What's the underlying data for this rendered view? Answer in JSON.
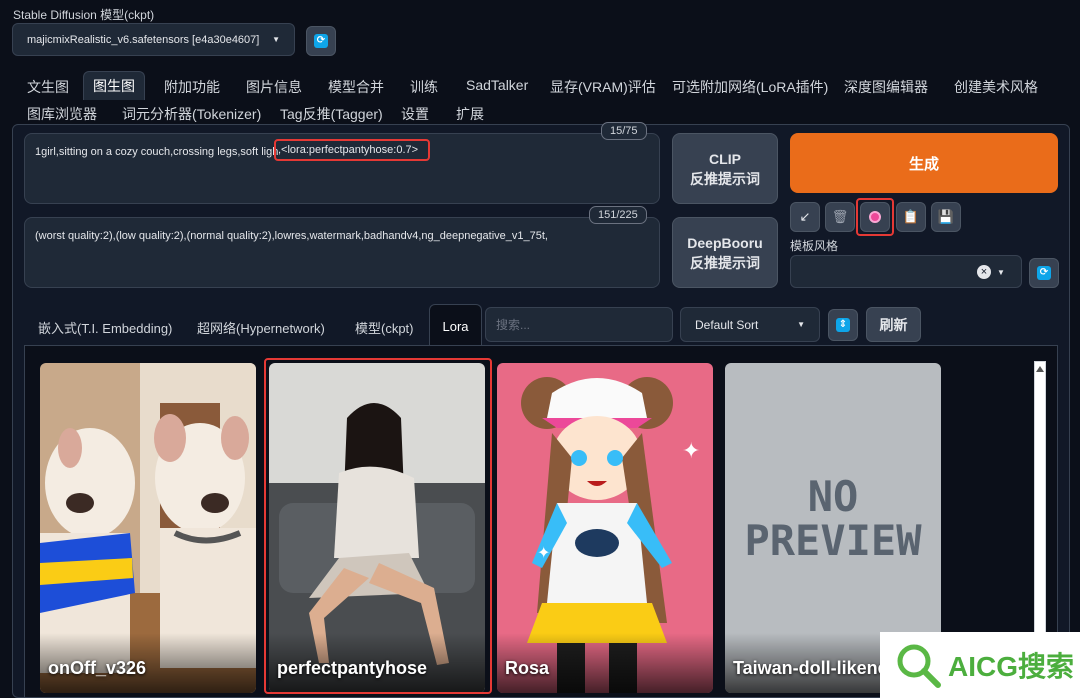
{
  "model": {
    "label": "Stable Diffusion 模型(ckpt)",
    "selected": "majicmixRealistic_v6.safetensors [e4a30e4607]"
  },
  "tabs_row1": [
    "文生图",
    "图生图",
    "附加功能",
    "图片信息",
    "模型合并",
    "训练",
    "SadTalker",
    "显存(VRAM)评估",
    "可选附加网络(LoRA插件)",
    "深度图编辑器",
    "创建美术风格"
  ],
  "tabs_row2": [
    "图库浏览器",
    "词元分析器(Tokenizer)",
    "Tag反推(Tagger)",
    "设置",
    "扩展"
  ],
  "active_tab": "图生图",
  "prompt": {
    "text": "1girl,sitting on a cozy couch,crossing legs,soft ligh",
    "lora_tag": ",<lora:perfectpantyhose:0.7>",
    "tokens": "15/75"
  },
  "negative_prompt": {
    "text": "(worst quality:2),(low quality:2),(normal quality:2),lowres,watermark,badhandv4,ng_deepnegative_v1_75t,",
    "tokens": "151/225"
  },
  "buttons": {
    "clip_line1": "CLIP",
    "clip_line2": "反推提示词",
    "deepbooru_line1": "DeepBooru",
    "deepbooru_line2": "反推提示词",
    "generate": "生成",
    "refresh": "刷新"
  },
  "styles": {
    "label": "模板风格",
    "clear_symbol": "×"
  },
  "network_tabs": [
    "嵌入式(T.I. Embedding)",
    "超网络(Hypernetwork)",
    "模型(ckpt)",
    "Lora"
  ],
  "active_network_tab": "Lora",
  "search": {
    "placeholder": "搜索..."
  },
  "sort": {
    "selected": "Default Sort"
  },
  "cards": [
    {
      "name": "onOff_v326"
    },
    {
      "name": "perfectpantyhose"
    },
    {
      "name": "Rosa"
    },
    {
      "name": "Taiwan-doll-likeness",
      "preview_text": "NO PREVIEW"
    }
  ],
  "watermark": {
    "text": "AICG搜索"
  },
  "colors": {
    "accent_orange": "#ea6c1a",
    "highlight_red": "#e53935",
    "background": "#0b0f19",
    "panel": "#111827"
  }
}
